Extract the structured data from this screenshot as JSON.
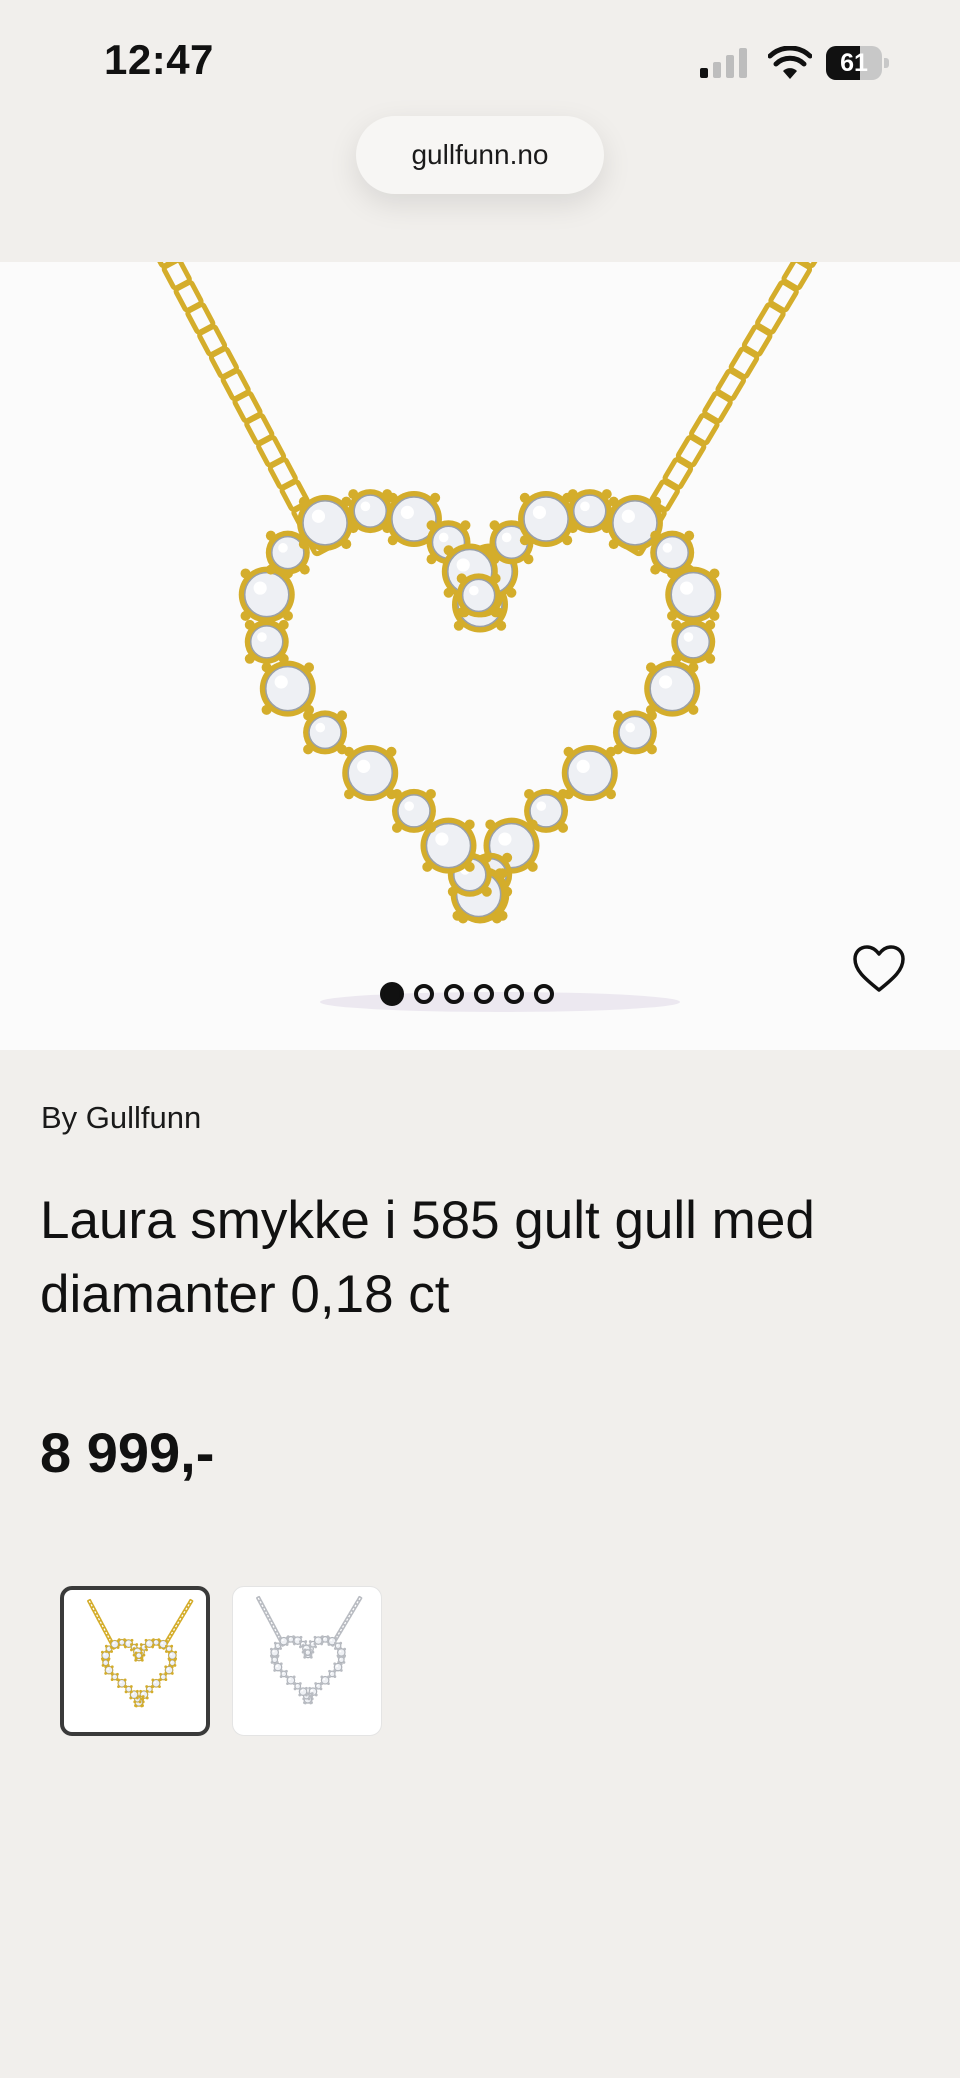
{
  "status_bar": {
    "time": "12:47",
    "battery_level": "61",
    "battery_fraction": 0.61,
    "signal_bars_active": 1,
    "signal_bars_total": 4
  },
  "browser": {
    "url": "gullfunn.no"
  },
  "gallery": {
    "image_count": 6,
    "active_index": 0,
    "favorite_icon": "heart-outline-icon"
  },
  "product": {
    "brand": "By Gullfunn",
    "title": "Laura smykke i 585 gult gull med diamanter 0,18 ct",
    "price": "8 999,-"
  },
  "variants": [
    {
      "name": "gold",
      "selected": true,
      "metal_color": "#d4ad2b"
    },
    {
      "name": "silver",
      "selected": false,
      "metal_color": "#b9bcc2"
    }
  ],
  "colors": {
    "background": "#f1efec",
    "gold": "#d4ad2b",
    "diamond": "#eef0f4"
  }
}
